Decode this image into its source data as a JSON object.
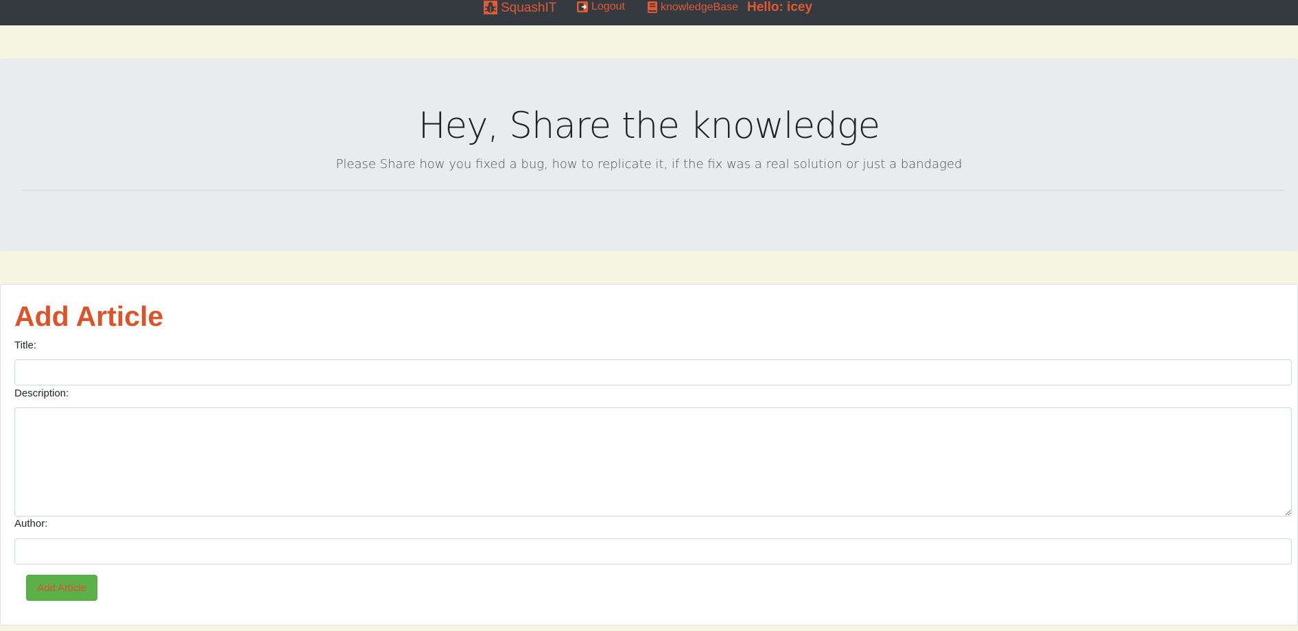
{
  "navbar": {
    "brand_label": "SquashIT",
    "brand_icon": "bug-icon",
    "logout_label": "Logout",
    "logout_icon": "sign-out-icon",
    "knowledgebase_label": "knowledgeBase",
    "knowledgebase_icon": "book-icon",
    "greeting": "Hello: icey"
  },
  "hero": {
    "heading": "Hey, Share the knowledge",
    "lead": "Please Share how you fixed a bug, how to replicate it, if the fix was a real solution or just a bandaged"
  },
  "form": {
    "title": "Add Article",
    "title_label": "Title:",
    "title_value": "",
    "description_label": "Description:",
    "description_value": "",
    "author_label": "Author:",
    "author_value": "",
    "submit_label": "Add Article"
  },
  "colors": {
    "accent": "#d9532c",
    "navbar_bg": "#343a40",
    "page_bg": "#f4f6e2",
    "hero_bg": "#e9ebef",
    "button_bg": "#5cb04c"
  }
}
